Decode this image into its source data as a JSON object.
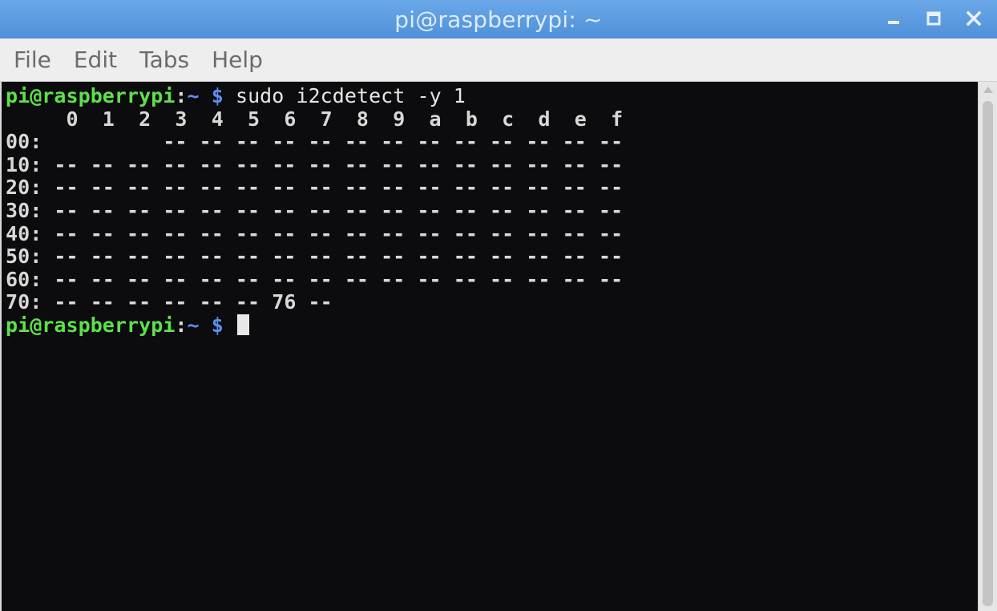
{
  "window": {
    "title": "pi@raspberrypi: ~",
    "controls": [
      {
        "name": "minimize-icon"
      },
      {
        "name": "maximize-icon"
      },
      {
        "name": "close-icon"
      }
    ]
  },
  "menubar": {
    "items": [
      "File",
      "Edit",
      "Tabs",
      "Help"
    ]
  },
  "terminal": {
    "prompt": {
      "user_host": "pi@raspberrypi",
      "separator": ":",
      "dir": "~",
      "dollar": "$"
    },
    "command": "sudo i2cdetect -y 1",
    "output_lines": [
      "     0  1  2  3  4  5  6  7  8  9  a  b  c  d  e  f",
      "00:          -- -- -- -- -- -- -- -- -- -- -- -- --",
      "10: -- -- -- -- -- -- -- -- -- -- -- -- -- -- -- --",
      "20: -- -- -- -- -- -- -- -- -- -- -- -- -- -- -- --",
      "30: -- -- -- -- -- -- -- -- -- -- -- -- -- -- -- --",
      "40: -- -- -- -- -- -- -- -- -- -- -- -- -- -- -- --",
      "50: -- -- -- -- -- -- -- -- -- -- -- -- -- -- -- --",
      "60: -- -- -- -- -- -- -- -- -- -- -- -- -- -- -- --",
      "70: -- -- -- -- -- -- 76 --"
    ]
  },
  "colors": {
    "titlebar": "#4f90d9",
    "prompt_user": "#5ee14a",
    "prompt_dir": "#5d8ff0",
    "terminal_bg": "#0c0b0d",
    "terminal_fg": "#d8d8d8"
  }
}
